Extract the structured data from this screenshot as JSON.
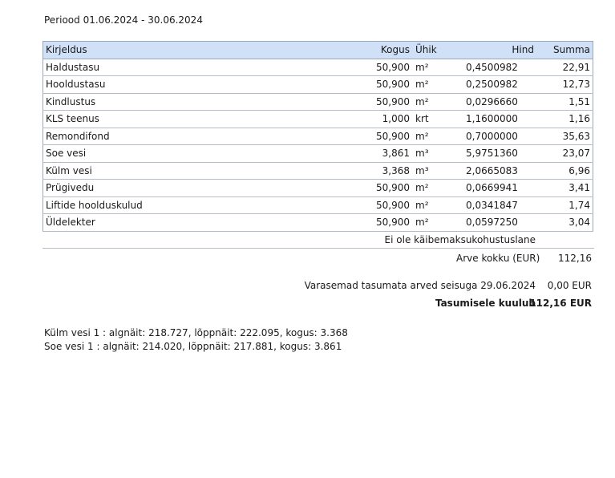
{
  "period": "Periood 01.06.2024 - 30.06.2024",
  "table": {
    "headers": {
      "desc": "Kirjeldus",
      "qty": "Kogus",
      "unit": "Ühik",
      "price": "Hind",
      "sum": "Summa"
    },
    "rows": [
      {
        "desc": "Haldustasu",
        "qty": "50,900",
        "unit": "m²",
        "price": "0,4500982",
        "sum": "22,91"
      },
      {
        "desc": "Hooldustasu",
        "qty": "50,900",
        "unit": "m²",
        "price": "0,2500982",
        "sum": "12,73"
      },
      {
        "desc": "Kindlustus",
        "qty": "50,900",
        "unit": "m²",
        "price": "0,0296660",
        "sum": "1,51"
      },
      {
        "desc": "KLS teenus",
        "qty": "1,000",
        "unit": "krt",
        "price": "1,1600000",
        "sum": "1,16"
      },
      {
        "desc": "Remondifond",
        "qty": "50,900",
        "unit": "m²",
        "price": "0,7000000",
        "sum": "35,63"
      },
      {
        "desc": "Soe vesi",
        "qty": "3,861",
        "unit": "m³",
        "price": "5,9751360",
        "sum": "23,07"
      },
      {
        "desc": "Külm vesi",
        "qty": "3,368",
        "unit": "m³",
        "price": "2,0665083",
        "sum": "6,96"
      },
      {
        "desc": "Prügivedu",
        "qty": "50,900",
        "unit": "m²",
        "price": "0,0669941",
        "sum": "3,41"
      },
      {
        "desc": "Liftide hoolduskulud",
        "qty": "50,900",
        "unit": "m²",
        "price": "0,0341847",
        "sum": "1,74"
      },
      {
        "desc": "Üldelekter",
        "qty": "50,900",
        "unit": "m²",
        "price": "0,0597250",
        "sum": "3,04"
      }
    ]
  },
  "vat_note": "Ei ole käibemaksukohustuslane",
  "invoice_total": {
    "label": "Arve kokku  (EUR)",
    "value": "112,16"
  },
  "previous_unpaid": {
    "label": "Varasemad tasumata arved seisuga 29.06.2024",
    "value": "0,00 EUR"
  },
  "amount_due": {
    "label": "Tasumisele kuulub",
    "value": "112,16 EUR"
  },
  "meters": [
    "Külm vesi 1 :  algnäit: 218.727, lõppnäit: 222.095, kogus: 3.368",
    "Soe vesi 1 :  algnäit: 214.020, lõppnäit: 217.881, kogus: 3.861"
  ]
}
